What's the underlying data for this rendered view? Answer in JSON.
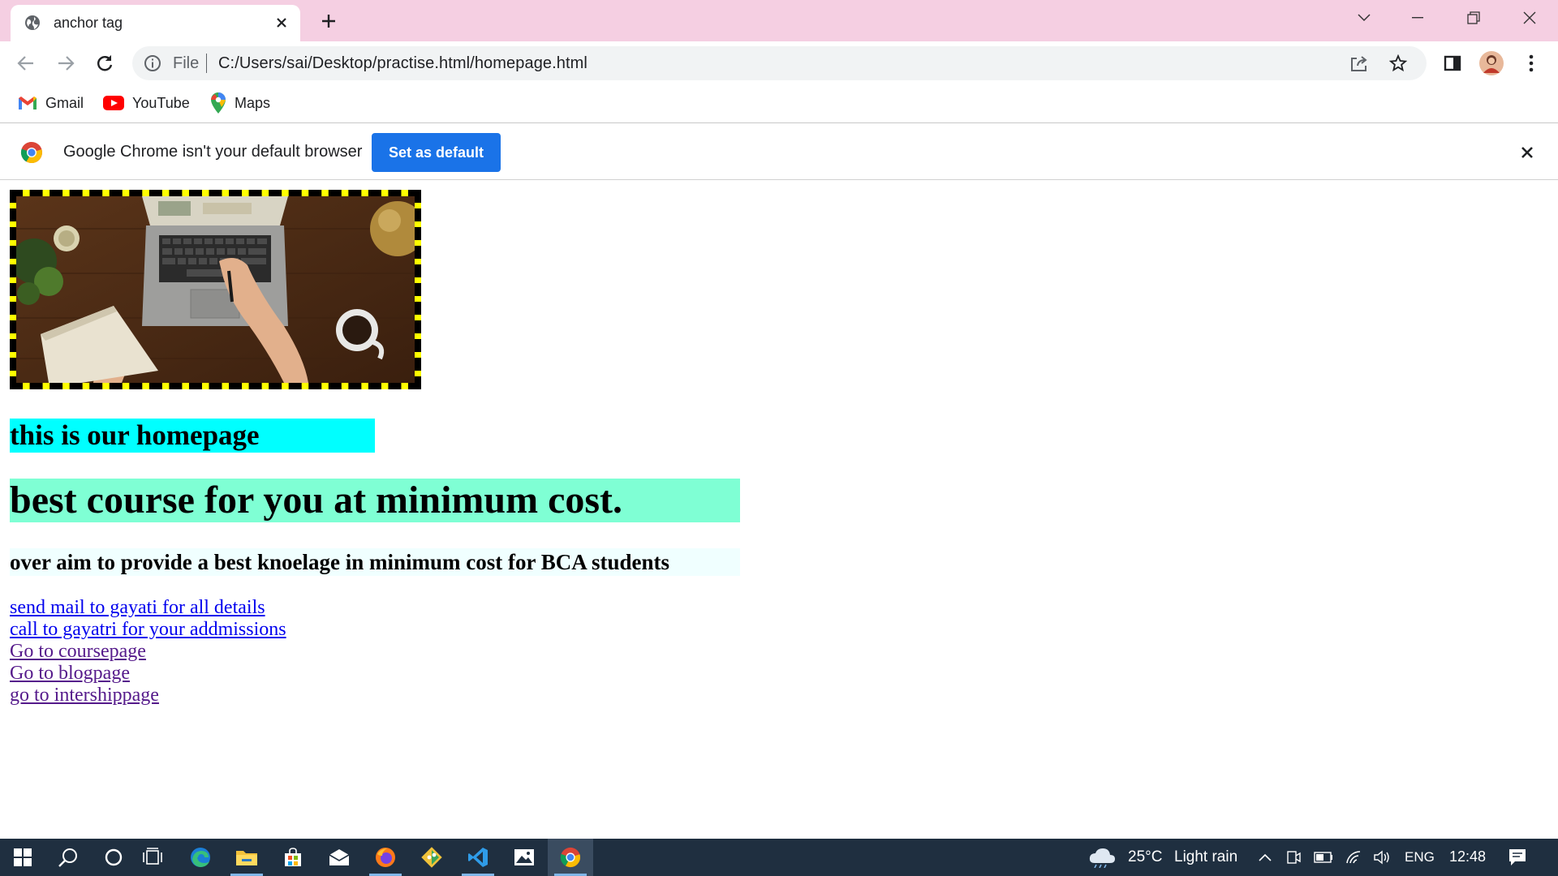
{
  "browser": {
    "tab": {
      "title": "anchor tag",
      "favicon": "globe-icon"
    },
    "window_controls": [
      "chevron-down-icon",
      "minimize-icon",
      "restore-icon",
      "close-icon"
    ],
    "omnibox": {
      "scheme": "File",
      "url": "C:/Users/sai/Desktop/practise.html/homepage.html"
    },
    "bookmarks": [
      {
        "label": "Gmail",
        "icon": "gmail-icon"
      },
      {
        "label": "YouTube",
        "icon": "youtube-icon"
      },
      {
        "label": "Maps",
        "icon": "maps-icon"
      }
    ],
    "infobar": {
      "message": "Google Chrome isn't your default browser",
      "button": "Set as default"
    }
  },
  "page": {
    "heading_homepage": "this is our homepage",
    "heading_course": "best course for you at minimum cost.",
    "heading_aim": "over aim to provide a best knoelage in minimum cost for BCA students",
    "links": [
      {
        "text": "send mail to gayati for all details",
        "state": "unvisited"
      },
      {
        "text": "call to gayatri for your addmissions",
        "state": "unvisited"
      },
      {
        "text": "Go to coursepage",
        "state": "visited"
      },
      {
        "text": "Go to blogpage",
        "state": "visited"
      },
      {
        "text": "go to intershippage",
        "state": "visited"
      }
    ],
    "colors": {
      "heading_homepage_bg": "#00ffff",
      "heading_course_bg": "#7fffd4",
      "heading_aim_bg": "#f0ffff",
      "image_border": "#ffff00"
    }
  },
  "taskbar": {
    "apps": [
      "windows-start-icon",
      "search-icon",
      "cortana-icon",
      "task-view-icon",
      "edge-icon",
      "file-explorer-icon",
      "store-icon",
      "mail-icon",
      "firefox-icon",
      "git-icon",
      "vscode-icon",
      "photos-icon",
      "chrome-icon"
    ],
    "weather": {
      "temp": "25°C",
      "condition": "Light rain"
    },
    "language": "ENG",
    "time": "12:48"
  }
}
